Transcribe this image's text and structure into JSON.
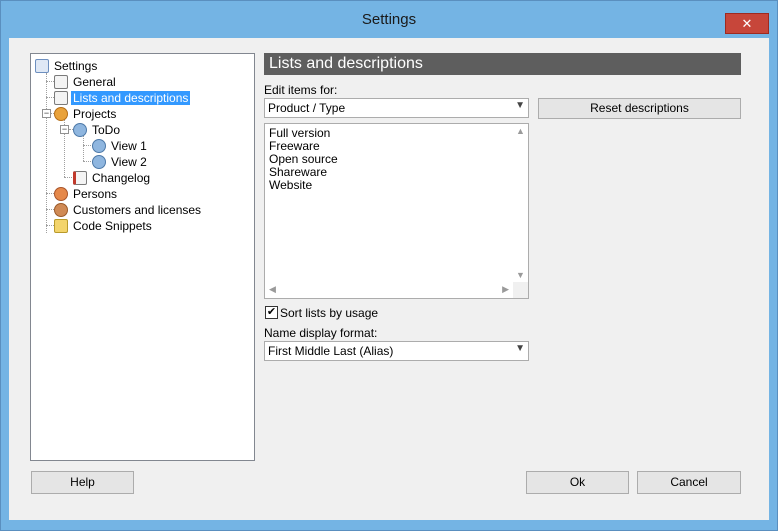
{
  "window": {
    "title": "Settings",
    "close_glyph": "✕"
  },
  "tree": {
    "root": "Settings",
    "general": "General",
    "lists": "Lists and descriptions",
    "projects": "Projects",
    "todo": "ToDo",
    "view1": "View 1",
    "view2": "View 2",
    "changelog": "Changelog",
    "persons": "Persons",
    "customers": "Customers and licenses",
    "snippets": "Code Snippets",
    "expander_glyph": "−"
  },
  "panel": {
    "title": "Lists and descriptions",
    "edit_items_label": "Edit items for:",
    "edit_items_value": "Product / Type",
    "reset_button": "Reset descriptions",
    "list_items": [
      "Full version",
      "Freeware",
      "Open source",
      "Shareware",
      "Website"
    ],
    "sort_label": "Sort lists by usage",
    "sort_checked": true,
    "check_glyph": "✔",
    "name_format_label": "Name display format:",
    "name_format_value": "First Middle Last (Alias)"
  },
  "footer": {
    "help": "Help",
    "ok": "Ok",
    "cancel": "Cancel"
  }
}
